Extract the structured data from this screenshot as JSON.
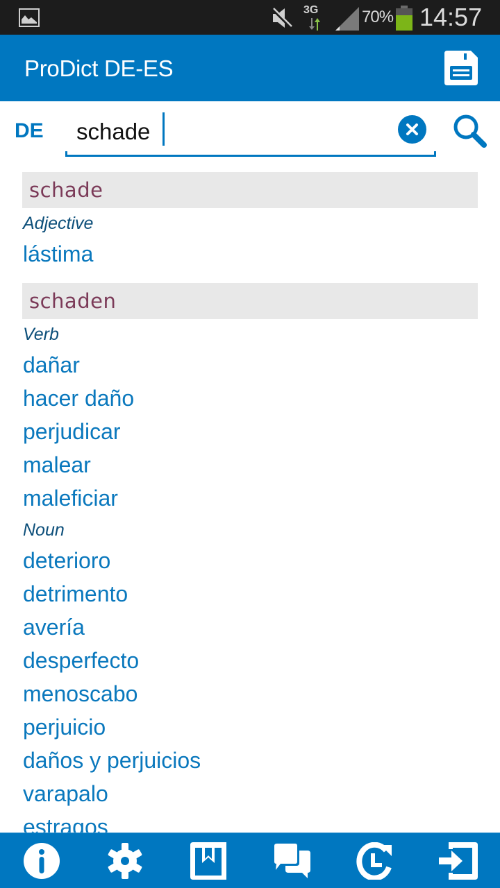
{
  "status_bar": {
    "left_icon": "gallery-icon",
    "icons": [
      "mute-icon",
      "network-3g-icon",
      "signal-icon",
      "battery-icon"
    ],
    "network_type": "3G",
    "battery_percent": "70%",
    "battery_level": 0.7,
    "time": "14:57"
  },
  "app_bar": {
    "title": "ProDict DE-ES",
    "save_icon": "floppy-disk-icon"
  },
  "search": {
    "language": "DE",
    "value": "schade",
    "clear_icon": "clear-circle-icon",
    "search_icon": "magnifier-icon"
  },
  "results": {
    "entries": [
      {
        "headword": "schade",
        "groups": [
          {
            "pos": "Adjective",
            "translations": [
              "lástima"
            ]
          }
        ]
      },
      {
        "headword": "schaden",
        "groups": [
          {
            "pos": "Verb",
            "translations": [
              "dañar",
              "hacer daño",
              "perjudicar",
              "malear",
              "maleficiar"
            ]
          },
          {
            "pos": "Noun",
            "translations": [
              "deterioro",
              "detrimento",
              "avería",
              "desperfecto",
              "menoscabo",
              "perjuicio",
              "daños y perjuicios",
              "varapalo",
              "estragos"
            ]
          }
        ]
      }
    ]
  },
  "bottom_bar": {
    "buttons": [
      {
        "name": "info",
        "icon": "info-icon"
      },
      {
        "name": "settings",
        "icon": "gear-icon"
      },
      {
        "name": "bookmarks",
        "icon": "bookmark-book-icon"
      },
      {
        "name": "feedback",
        "icon": "chat-bubbles-icon"
      },
      {
        "name": "history",
        "icon": "history-icon"
      },
      {
        "name": "exit",
        "icon": "exit-icon"
      }
    ]
  },
  "colors": {
    "primary": "#0077c0",
    "headword": "#7b3a58",
    "headword_bg": "#e8e8e8",
    "pos": "#0d4f7a",
    "translation": "#0a78bd",
    "status_bar": "#1c1c1c",
    "battery": "#7cb518"
  }
}
